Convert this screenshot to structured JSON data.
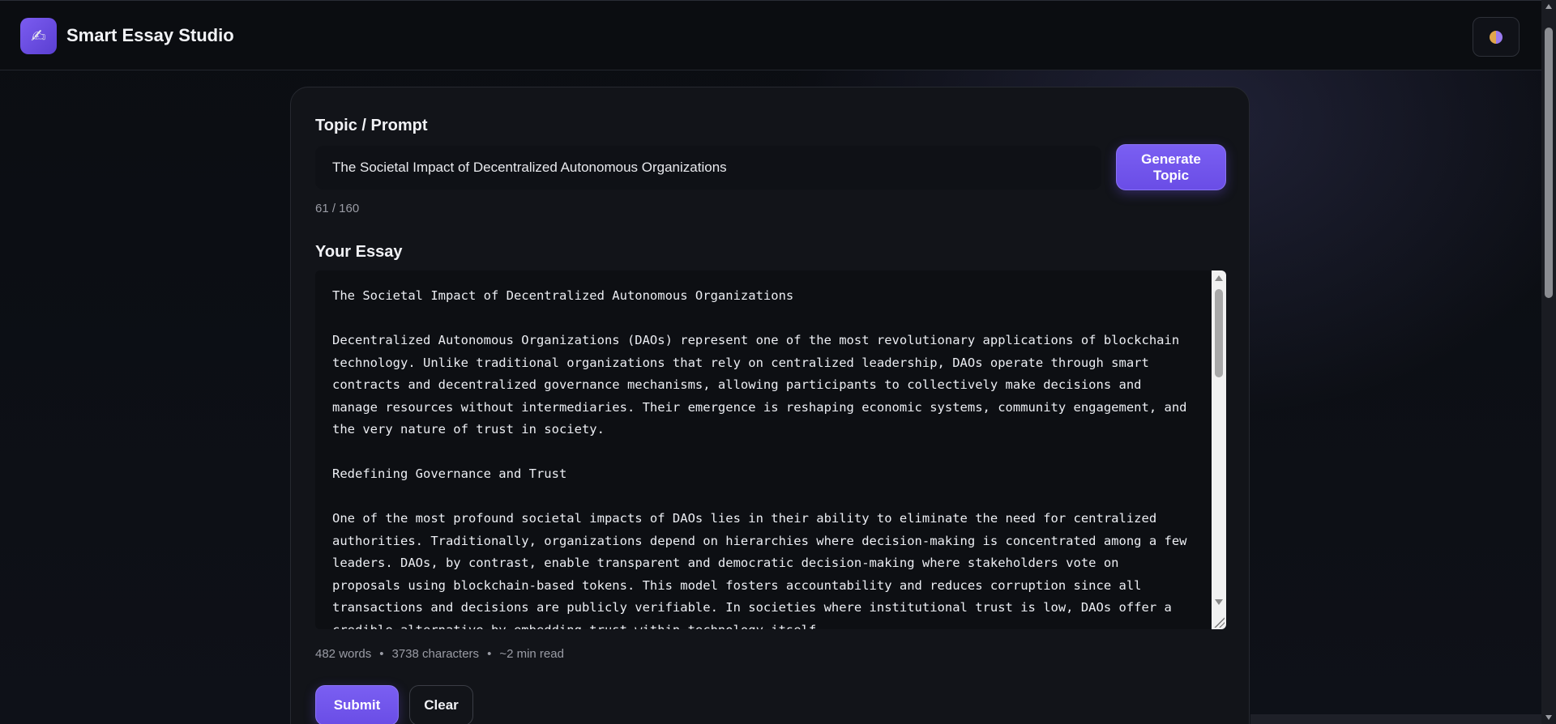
{
  "app": {
    "logo_glyph": "✍",
    "title": "Smart Essay Studio"
  },
  "header": {
    "theme_toggle_icon": "theme-toggle-icon"
  },
  "topic": {
    "label": "Topic / Prompt",
    "value": "The Societal Impact of Decentralized Autonomous Organizations",
    "generate_button": "Generate Topic",
    "counter": "61 / 160"
  },
  "essay": {
    "label": "Your Essay",
    "content": "The Societal Impact of Decentralized Autonomous Organizations\n\nDecentralized Autonomous Organizations (DAOs) represent one of the most revolutionary applications of blockchain technology. Unlike traditional organizations that rely on centralized leadership, DAOs operate through smart contracts and decentralized governance mechanisms, allowing participants to collectively make decisions and manage resources without intermediaries. Their emergence is reshaping economic systems, community engagement, and the very nature of trust in society.\n\nRedefining Governance and Trust\n\nOne of the most profound societal impacts of DAOs lies in their ability to eliminate the need for centralized authorities. Traditionally, organizations depend on hierarchies where decision-making is concentrated among a few leaders. DAOs, by contrast, enable transparent and democratic decision-making where stakeholders vote on proposals using blockchain-based tokens. This model fosters accountability and reduces corruption since all transactions and decisions are publicly verifiable. In societies where institutional trust is low, DAOs offer a credible alternative by embedding trust within technology itself.",
    "words": "482 words",
    "characters": "3738 characters",
    "read_time": "~2 min read",
    "separator": "•"
  },
  "actions": {
    "submit": "Submit",
    "clear": "Clear"
  },
  "colors": {
    "accent": "#7a5ff2",
    "background": "#0c0e13",
    "card": "#121419"
  }
}
